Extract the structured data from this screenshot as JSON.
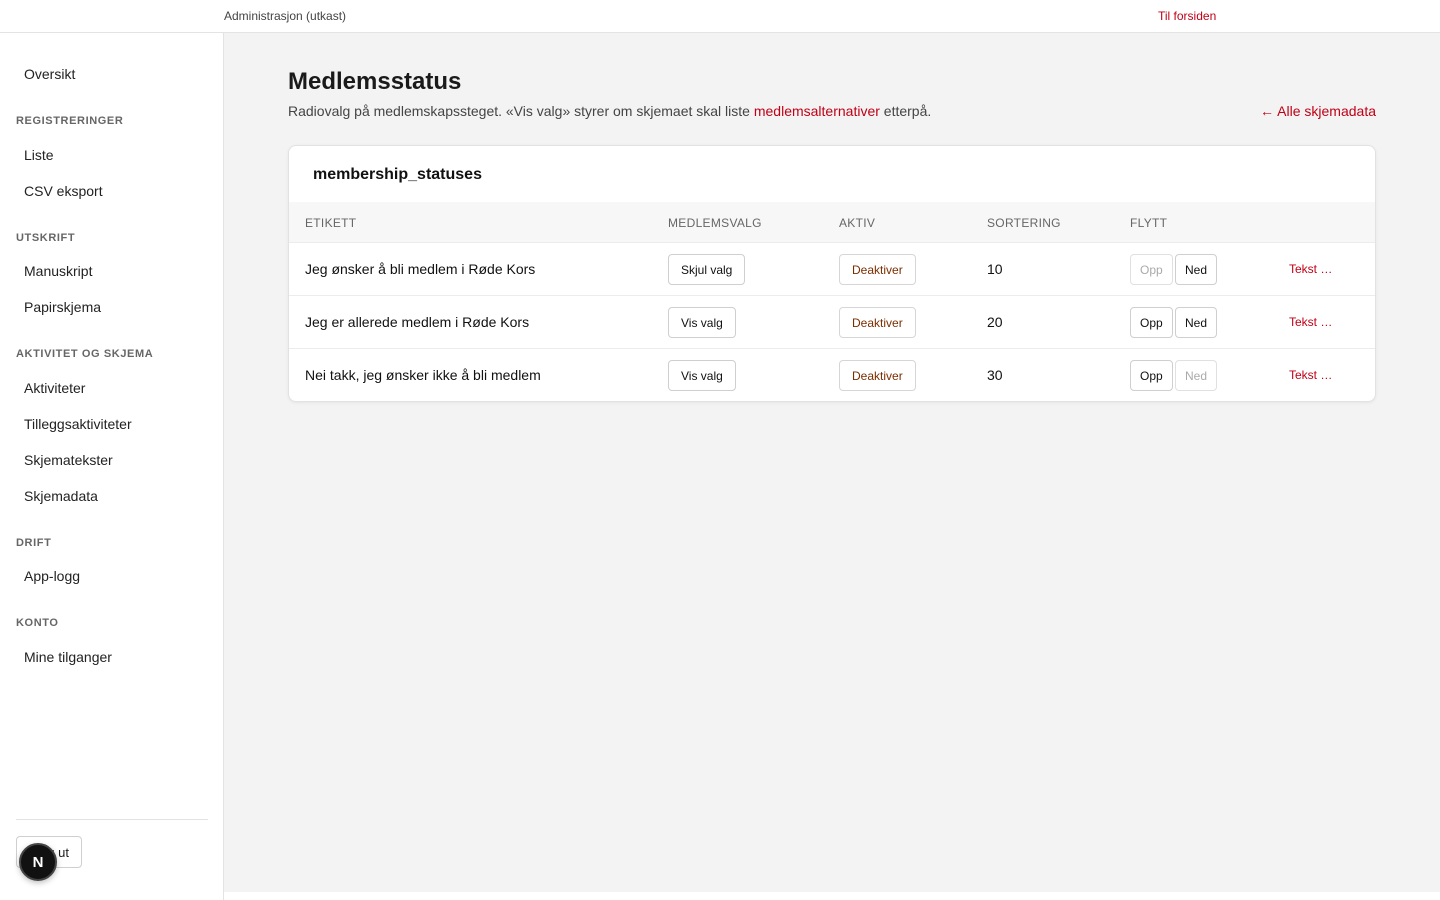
{
  "topbar": {
    "app_title": "Administrasjon (utkast)",
    "home_link": "Til forsiden"
  },
  "sidebar": {
    "overview": "Oversikt",
    "sections": {
      "registrations": {
        "title": "REGISTRERINGER",
        "items": [
          "Liste",
          "CSV eksport"
        ]
      },
      "print": {
        "title": "UTSKRIFT",
        "items": [
          "Manuskript",
          "Papirskjema"
        ]
      },
      "activity": {
        "title": "AKTIVITET OG SKJEMA",
        "items": [
          "Aktiviteter",
          "Tilleggsaktiviteter",
          "Skjematekster",
          "Skjemadata"
        ]
      },
      "ops": {
        "title": "DRIFT",
        "items": [
          "App-logg"
        ]
      },
      "account": {
        "title": "KONTO",
        "items": [
          "Mine tilganger"
        ]
      }
    },
    "logout": "Logg ut",
    "badge": "N"
  },
  "main": {
    "title": "Medlemsstatus",
    "description_before": "Radiovalg på medlemskapssteget. «Vis valg» styrer om skjemaet skal liste ",
    "description_link": "medlemsalternativer",
    "description_after": " etterpå.",
    "back_link": "← Alle skjemadata"
  },
  "table": {
    "title": "membership_statuses",
    "headers": {
      "label": "ETIKETT",
      "member_choice": "MEDLEMSVALG",
      "active": "AKTIV",
      "sort": "SORTERING",
      "move": "FLYTT"
    },
    "rows": [
      {
        "label": "Jeg ønsker å bli medlem i Røde Kors",
        "choice_button": "Skjul valg",
        "active_button": "Deaktiver",
        "sort": "10",
        "up": "Opp",
        "down": "Ned",
        "text_link": "Tekst …"
      },
      {
        "label": "Jeg er allerede medlem i Røde Kors",
        "choice_button": "Vis valg",
        "active_button": "Deaktiver",
        "sort": "20",
        "up": "Opp",
        "down": "Ned",
        "text_link": "Tekst …"
      },
      {
        "label": "Nei takk, jeg ønsker ikke å bli medlem",
        "choice_button": "Vis valg",
        "active_button": "Deaktiver",
        "sort": "30",
        "up": "Opp",
        "down": "Ned",
        "text_link": "Tekst …"
      }
    ]
  },
  "colors": {
    "accent": "#c00016",
    "background": "#f3f3f3",
    "deactivate_text": "#7a2e00"
  }
}
